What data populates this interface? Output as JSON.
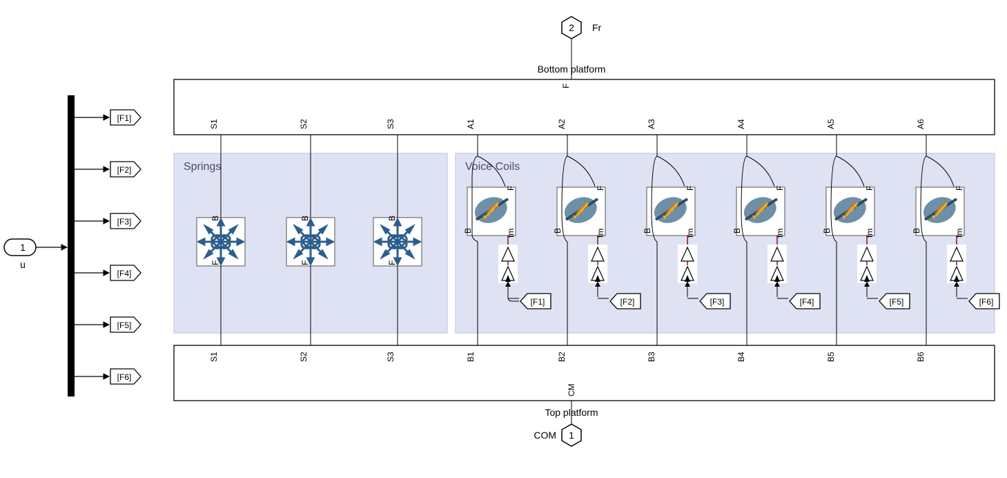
{
  "input_port": {
    "number": "1",
    "name": "u"
  },
  "demux_tags": [
    "[F1]",
    "[F2]",
    "[F3]",
    "[F4]",
    "[F5]",
    "[F6]"
  ],
  "top_port": {
    "number": "2",
    "name": "Fr"
  },
  "bottom_platform": {
    "title": "Bottom platform",
    "f_port": "F",
    "s_ports": [
      "S1",
      "S2",
      "S3"
    ],
    "a_ports": [
      "A1",
      "A2",
      "A3",
      "A4",
      "A5",
      "A6"
    ]
  },
  "springs_group": {
    "title": "Springs",
    "blocks": [
      {
        "b": "B",
        "f": "F"
      },
      {
        "b": "B",
        "f": "F"
      },
      {
        "b": "B",
        "f": "F"
      }
    ]
  },
  "voicecoils_group": {
    "title": "Voice Coils",
    "blocks": [
      {
        "b": "B",
        "f": "F",
        "fm": "fm",
        "tag": "[F1]"
      },
      {
        "b": "B",
        "f": "F",
        "fm": "fm",
        "tag": "[F2]"
      },
      {
        "b": "B",
        "f": "F",
        "fm": "fm",
        "tag": "[F3]"
      },
      {
        "b": "B",
        "f": "F",
        "fm": "fm",
        "tag": "[F4]"
      },
      {
        "b": "B",
        "f": "F",
        "fm": "fm",
        "tag": "[F5]"
      },
      {
        "b": "B",
        "f": "F",
        "fm": "fm",
        "tag": "[F6]"
      }
    ]
  },
  "top_platform": {
    "title": "Top platform",
    "s_ports": [
      "S1",
      "S2",
      "S3"
    ],
    "b_ports": [
      "B1",
      "B2",
      "B3",
      "B4",
      "B5",
      "B6"
    ],
    "cm": "CM"
  },
  "bottom_port": {
    "number": "1",
    "name": "COM"
  },
  "chart_data": null
}
